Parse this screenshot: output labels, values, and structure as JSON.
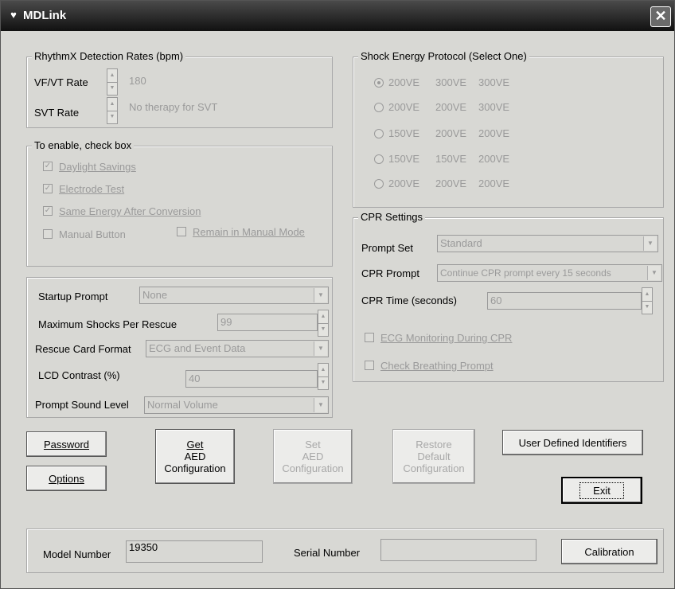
{
  "window": {
    "title": "MDLink",
    "icon": "heart-icon",
    "close_glyph": "✕"
  },
  "rhythmix": {
    "title": "RhythmX Detection Rates (bpm)",
    "vfvt_label": "VF/VT Rate",
    "vfvt_value": "180",
    "svt_label": "SVT Rate",
    "svt_value": "No therapy for SVT"
  },
  "enable": {
    "title": "To enable, check box",
    "daylight": "Daylight Savings",
    "electrode": "Electrode Test",
    "same_energy": "Same Energy After Conversion",
    "manual_button": "Manual Button",
    "remain_manual": "Remain in Manual Mode",
    "daylight_checked": true,
    "electrode_checked": true,
    "same_energy_checked": true,
    "manual_button_checked": false,
    "remain_manual_checked": false
  },
  "settings": {
    "startup_label": "Startup Prompt",
    "startup_value": "None",
    "max_shocks_label": "Maximum Shocks Per Rescue",
    "max_shocks_value": "99",
    "rescue_card_label": "Rescue Card Format",
    "rescue_card_value": "ECG and Event Data",
    "lcd_label": "LCD  Contrast   (%)",
    "lcd_value": "40",
    "sound_label": "Prompt Sound Level",
    "sound_value": "Normal Volume"
  },
  "shock": {
    "title": "Shock Energy Protocol (Select One)",
    "options": [
      {
        "e1": "200VE",
        "e2": "300VE",
        "e3": "300VE"
      },
      {
        "e1": "200VE",
        "e2": "200VE",
        "e3": "300VE"
      },
      {
        "e1": "150VE",
        "e2": "200VE",
        "e3": "200VE"
      },
      {
        "e1": "150VE",
        "e2": "150VE",
        "e3": "200VE"
      },
      {
        "e1": "200VE",
        "e2": "200VE",
        "e3": "200VE"
      }
    ],
    "selected_index": 0
  },
  "cpr": {
    "title": "CPR Settings",
    "prompt_set_label": "Prompt Set",
    "prompt_set_value": "Standard",
    "cpr_prompt_label": "CPR Prompt",
    "cpr_prompt_value": "Continue CPR prompt every 15 seconds",
    "cpr_time_label": "CPR Time  (seconds)",
    "cpr_time_value": "60",
    "ecg_monitoring": "ECG Monitoring During CPR",
    "check_breathing": "Check Breathing Prompt",
    "ecg_monitoring_checked": false,
    "check_breathing_checked": false
  },
  "buttons": {
    "password": "Password",
    "options": "Options",
    "get_l1": "Get",
    "get_l2": "AED",
    "get_l3": "Configuration",
    "set_l1": "Set",
    "set_l2": "AED",
    "set_l3": "Configuration",
    "restore_l1": "Restore",
    "restore_l2": "Default",
    "restore_l3": "Configuration",
    "user_defined": "User Defined Identifiers",
    "exit": "Exit",
    "calibration": "Calibration"
  },
  "bottom": {
    "model_label": "Model Number",
    "model_value": "19350",
    "serial_label": "Serial Number",
    "serial_value": ""
  }
}
